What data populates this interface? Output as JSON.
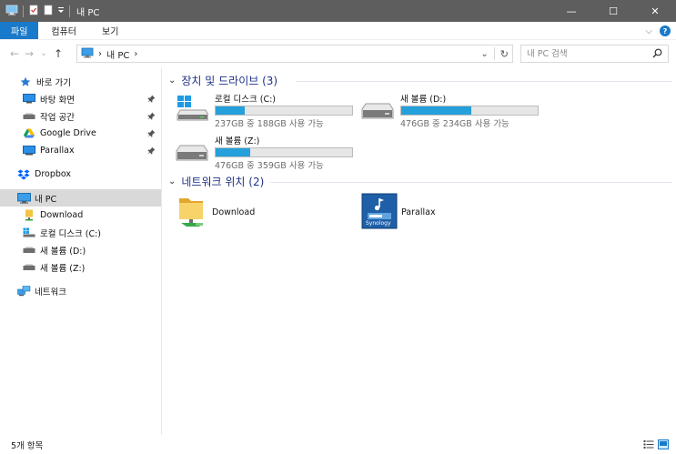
{
  "window": {
    "title": "내 PC",
    "minimize": "—",
    "maximize": "☐",
    "close": "✕"
  },
  "ribbon": {
    "tabs": [
      {
        "label": "파일",
        "active": true
      },
      {
        "label": "컴퓨터",
        "active": false
      },
      {
        "label": "보기",
        "active": false
      }
    ],
    "expand": "⌵",
    "help": "?"
  },
  "address": {
    "back": "←",
    "forward": "→",
    "recent": "⌄",
    "up": "↑",
    "crumbs": [
      "›",
      "내 PC",
      "›"
    ],
    "dropdown": "⌄",
    "refresh": "↻"
  },
  "search": {
    "placeholder": "내 PC 검색"
  },
  "nav": {
    "quick_access": "바로 가기",
    "quick_items": [
      "바탕 화면",
      "작업 공간",
      "Google Drive",
      "Parallax"
    ],
    "dropbox": "Dropbox",
    "this_pc": "내 PC",
    "pc_items": [
      "Download",
      "로컬 디스크 (C:)",
      "새 볼륨 (D:)",
      "새 볼륨 (Z:)"
    ],
    "network": "네트워크"
  },
  "devices": {
    "header": "장치 및 드라이브 (3)",
    "chevron": "⌄",
    "drives": [
      {
        "name": "로컬 디스크 (C:)",
        "size": "237GB 중 188GB 사용 가능",
        "used_fraction": 0.21
      },
      {
        "name": "새 볼륨 (D:)",
        "size": "476GB 중 234GB 사용 가능",
        "used_fraction": 0.51
      },
      {
        "name": "새 볼륨 (Z:)",
        "size": "476GB 중 359GB 사용 가능",
        "used_fraction": 0.25
      }
    ]
  },
  "network_locations": {
    "header": "네트워크 위치 (2)",
    "chevron": "⌄",
    "items": [
      {
        "name": "Download"
      },
      {
        "name": "Parallax",
        "brand": "Synology"
      }
    ]
  },
  "status": {
    "count": "5개 항목"
  },
  "colors": {
    "accent": "#1979ca",
    "drive_fill": "#26a0da",
    "group_header": "#1e3287",
    "titlebar": "#5e5e5e"
  }
}
